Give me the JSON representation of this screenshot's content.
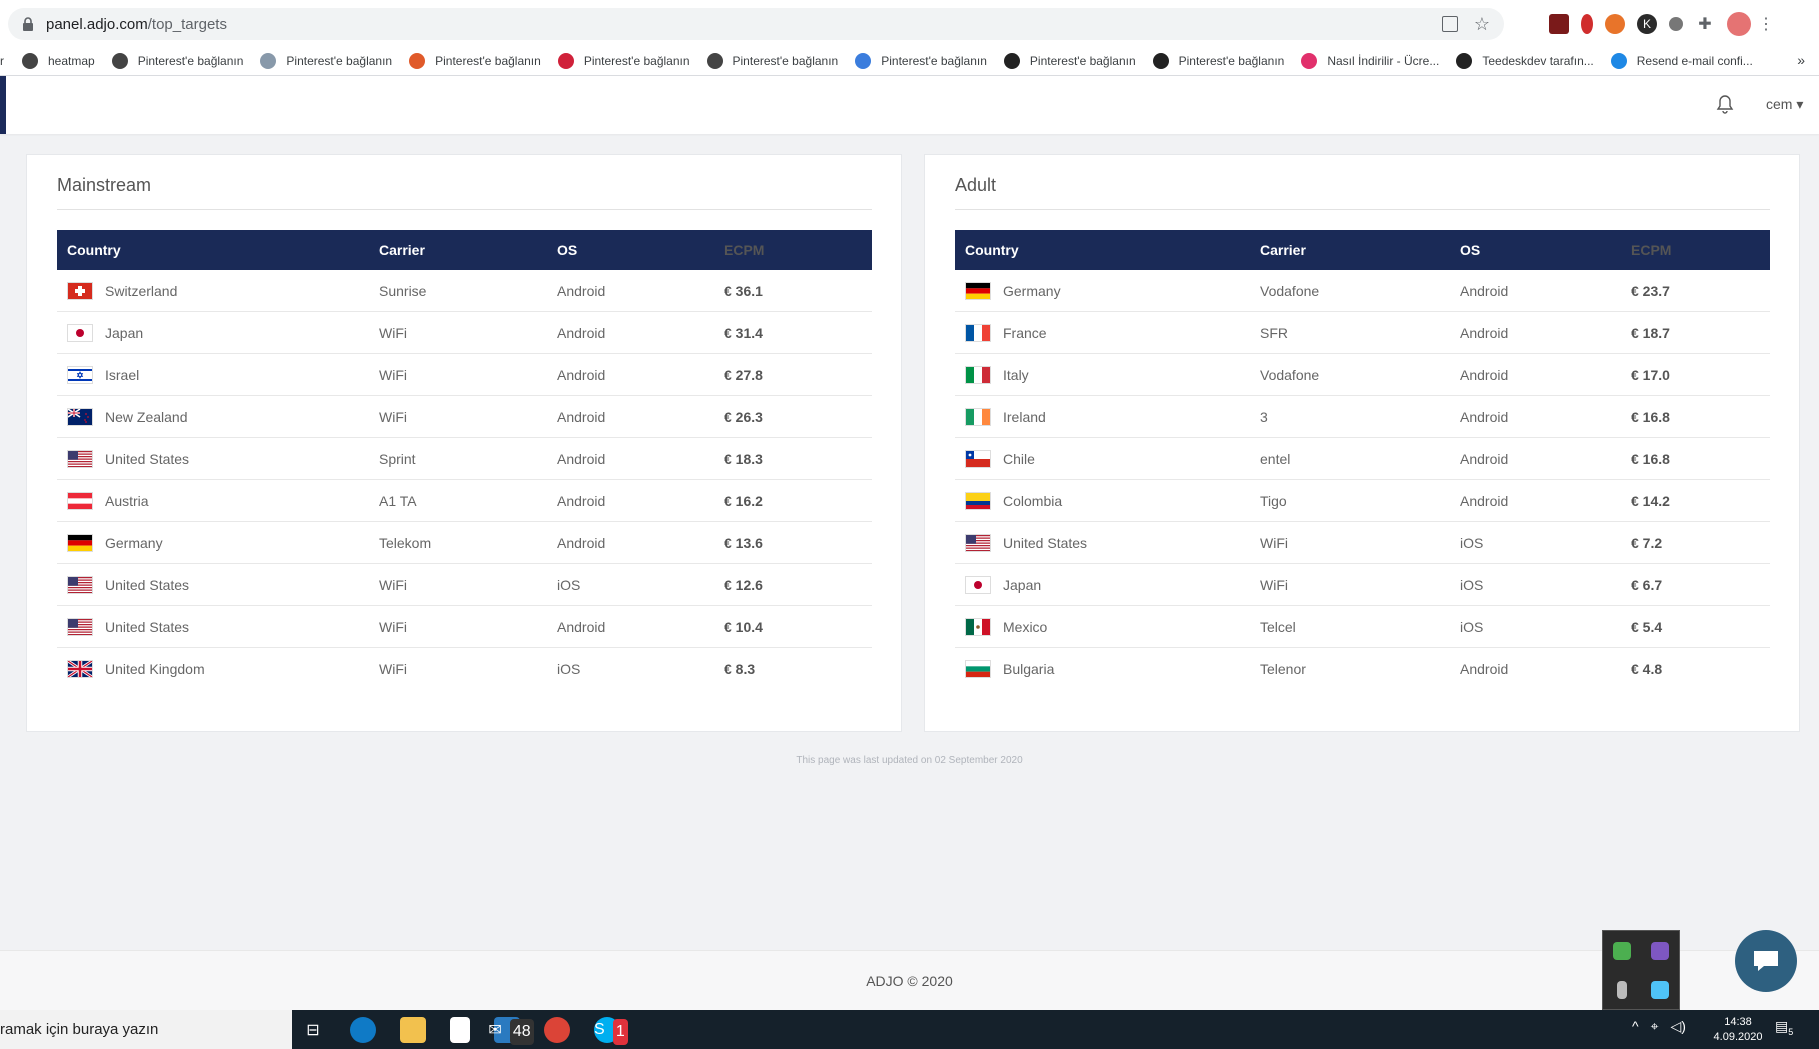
{
  "browser": {
    "url_host": "panel.adjo.com",
    "url_path": "/top_targets",
    "bookmarks": [
      {
        "label": "heatmap",
        "icon": "globe-icon",
        "color": "#444"
      },
      {
        "label": "Pinterest'e bağlanın",
        "icon": "globe-icon",
        "color": "#444"
      },
      {
        "label": "Pinterest'e bağlanın",
        "icon": "info-icon",
        "color": "#8899aa"
      },
      {
        "label": "Pinterest'e bağlanın",
        "icon": "gc-icon",
        "color": "#e05a2a"
      },
      {
        "label": "Pinterest'e bağlanın",
        "icon": "heart-icon",
        "color": "#d0213a"
      },
      {
        "label": "Pinterest'e bağlanın",
        "icon": "globe-icon",
        "color": "#444"
      },
      {
        "label": "Pinterest'e bağlanın",
        "icon": "c-icon",
        "color": "#3b7ddd"
      },
      {
        "label": "Pinterest'e bağlanın",
        "icon": "k-icon",
        "color": "#222"
      },
      {
        "label": "Pinterest'e bağlanın",
        "icon": "d-icon",
        "color": "#222"
      },
      {
        "label": "Nasıl İndirilir - Ücre...",
        "icon": "instagram-icon",
        "color": "#e1306c"
      },
      {
        "label": "Teedeskdev tarafın...",
        "icon": "arrow-icon",
        "color": "#222"
      },
      {
        "label": "Resend e-mail confi...",
        "icon": "mail-icon",
        "color": "#1e88e5"
      }
    ],
    "more": "»"
  },
  "header": {
    "user": "cem",
    "user_caret": "▾"
  },
  "mainstream": {
    "title": "Mainstream",
    "columns": [
      "Country",
      "Carrier",
      "OS",
      "ECPM"
    ],
    "rows": [
      {
        "country": "Switzerland",
        "flag": "ch",
        "carrier": "Sunrise",
        "os": "Android",
        "ecpm": "€ 36.1"
      },
      {
        "country": "Japan",
        "flag": "jp",
        "carrier": "WiFi",
        "os": "Android",
        "ecpm": "€ 31.4"
      },
      {
        "country": "Israel",
        "flag": "il",
        "carrier": "WiFi",
        "os": "Android",
        "ecpm": "€ 27.8"
      },
      {
        "country": "New Zealand",
        "flag": "nz",
        "carrier": "WiFi",
        "os": "Android",
        "ecpm": "€ 26.3"
      },
      {
        "country": "United States",
        "flag": "us",
        "carrier": "Sprint",
        "os": "Android",
        "ecpm": "€ 18.3"
      },
      {
        "country": "Austria",
        "flag": "at",
        "carrier": "A1 TA",
        "os": "Android",
        "ecpm": "€ 16.2"
      },
      {
        "country": "Germany",
        "flag": "de",
        "carrier": "Telekom",
        "os": "Android",
        "ecpm": "€ 13.6"
      },
      {
        "country": "United States",
        "flag": "us",
        "carrier": "WiFi",
        "os": "iOS",
        "ecpm": "€ 12.6"
      },
      {
        "country": "United States",
        "flag": "us",
        "carrier": "WiFi",
        "os": "Android",
        "ecpm": "€ 10.4"
      },
      {
        "country": "United Kingdom",
        "flag": "gb",
        "carrier": "WiFi",
        "os": "iOS",
        "ecpm": "€ 8.3"
      }
    ]
  },
  "adult": {
    "title": "Adult",
    "columns": [
      "Country",
      "Carrier",
      "OS",
      "ECPM"
    ],
    "rows": [
      {
        "country": "Germany",
        "flag": "de",
        "carrier": "Vodafone",
        "os": "Android",
        "ecpm": "€ 23.7"
      },
      {
        "country": "France",
        "flag": "fr",
        "carrier": "SFR",
        "os": "Android",
        "ecpm": "€ 18.7"
      },
      {
        "country": "Italy",
        "flag": "it",
        "carrier": "Vodafone",
        "os": "Android",
        "ecpm": "€ 17.0"
      },
      {
        "country": "Ireland",
        "flag": "ie",
        "carrier": "3",
        "os": "Android",
        "ecpm": "€ 16.8"
      },
      {
        "country": "Chile",
        "flag": "cl",
        "carrier": "entel",
        "os": "Android",
        "ecpm": "€ 16.8"
      },
      {
        "country": "Colombia",
        "flag": "co",
        "carrier": "Tigo",
        "os": "Android",
        "ecpm": "€ 14.2"
      },
      {
        "country": "United States",
        "flag": "us",
        "carrier": "WiFi",
        "os": "iOS",
        "ecpm": "€ 7.2"
      },
      {
        "country": "Japan",
        "flag": "jp",
        "carrier": "WiFi",
        "os": "iOS",
        "ecpm": "€ 6.7"
      },
      {
        "country": "Mexico",
        "flag": "mx",
        "carrier": "Telcel",
        "os": "iOS",
        "ecpm": "€ 5.4"
      },
      {
        "country": "Bulgaria",
        "flag": "bg",
        "carrier": "Telenor",
        "os": "Android",
        "ecpm": "€ 4.8"
      }
    ]
  },
  "updated_text": "This page was last updated on 02 September 2020",
  "footer": {
    "copyright": "ADJO © 2020"
  },
  "taskbar": {
    "search_text": "ramak için buraya yazın",
    "mail_badge": "48",
    "skype_badge": "1",
    "time": "14:38",
    "date": "4.09.2020",
    "notif_count": "5"
  },
  "colors": {
    "table_header": "#1a2a57",
    "accent": "#2e6080"
  }
}
